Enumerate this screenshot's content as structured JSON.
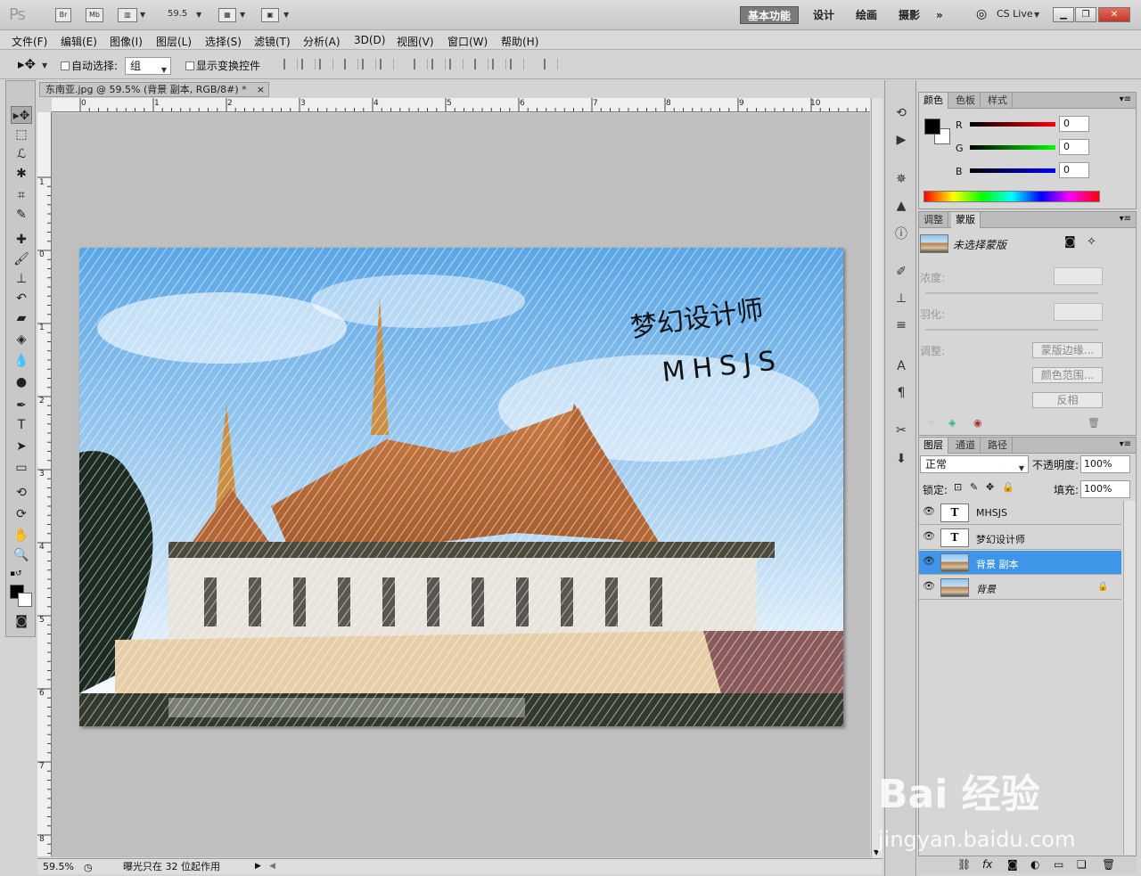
{
  "app": {
    "logo": "Ps",
    "bridge": "Br",
    "minibridge": "Mb",
    "zoom": "59.5",
    "workspaces": [
      "基本功能",
      "设计",
      "绘画",
      "摄影"
    ],
    "more": "»",
    "cs_live": "CS Live",
    "window_controls": [
      "minimize-icon",
      "restore-icon",
      "close-icon"
    ]
  },
  "menu": [
    "文件(F)",
    "编辑(E)",
    "图像(I)",
    "图层(L)",
    "选择(S)",
    "滤镜(T)",
    "分析(A)",
    "3D(D)",
    "视图(V)",
    "窗口(W)",
    "帮助(H)"
  ],
  "options": {
    "auto_select_label": "自动选择:",
    "auto_select_value": "组",
    "show_transform_label": "显示变换控件"
  },
  "document": {
    "tab_title": "东南亚.jpg @ 59.5% (背景 副本, RGB/8#) *",
    "close": "×",
    "ruler_h": [
      "0",
      "1",
      "2",
      "3",
      "4",
      "5",
      "6",
      "7",
      "8",
      "9",
      "10"
    ],
    "ruler_v": [
      "1",
      "0",
      "1",
      "2",
      "3",
      "4",
      "5",
      "6",
      "7",
      "8"
    ],
    "overlay_text_line1": "梦幻设计师",
    "overlay_text_line2": "MHSJS"
  },
  "status": {
    "zoom": "59.5%",
    "message": "曝光只在 32 位起作用"
  },
  "color_panel": {
    "tabs": [
      "颜色",
      "色板",
      "样式"
    ],
    "r_label": "R",
    "g_label": "G",
    "b_label": "B",
    "r": "0",
    "g": "0",
    "b": "0",
    "colors": {
      "fg": "#000000",
      "bg": "#ffffff"
    }
  },
  "masks_panel": {
    "tabs": [
      "调整",
      "蒙版"
    ],
    "title": "未选择蒙版",
    "density_label": "浓度:",
    "feather_label": "羽化:",
    "refine_label": "调整:",
    "btn_edge": "蒙版边缘...",
    "btn_range": "颜色范围...",
    "btn_invert": "反相"
  },
  "layers_panel": {
    "tabs": [
      "图层",
      "通道",
      "路径"
    ],
    "blend_mode": "正常",
    "opacity_label": "不透明度:",
    "opacity": "100%",
    "lock_label": "锁定:",
    "fill_label": "填充:",
    "fill": "100%",
    "layers": [
      {
        "name": "MHSJS",
        "type": "T"
      },
      {
        "name": "梦幻设计师",
        "type": "T"
      },
      {
        "name": "背景 副本",
        "type": "image"
      },
      {
        "name": "背景",
        "type": "image"
      }
    ],
    "bottom_icons": [
      "link-icon",
      "fx-icon",
      "mask-icon",
      "adjust-icon",
      "group-icon",
      "new-layer-icon",
      "trash-icon"
    ]
  },
  "watermark": {
    "brand": "Bai 经验",
    "url": "jingyan.baidu.com"
  }
}
